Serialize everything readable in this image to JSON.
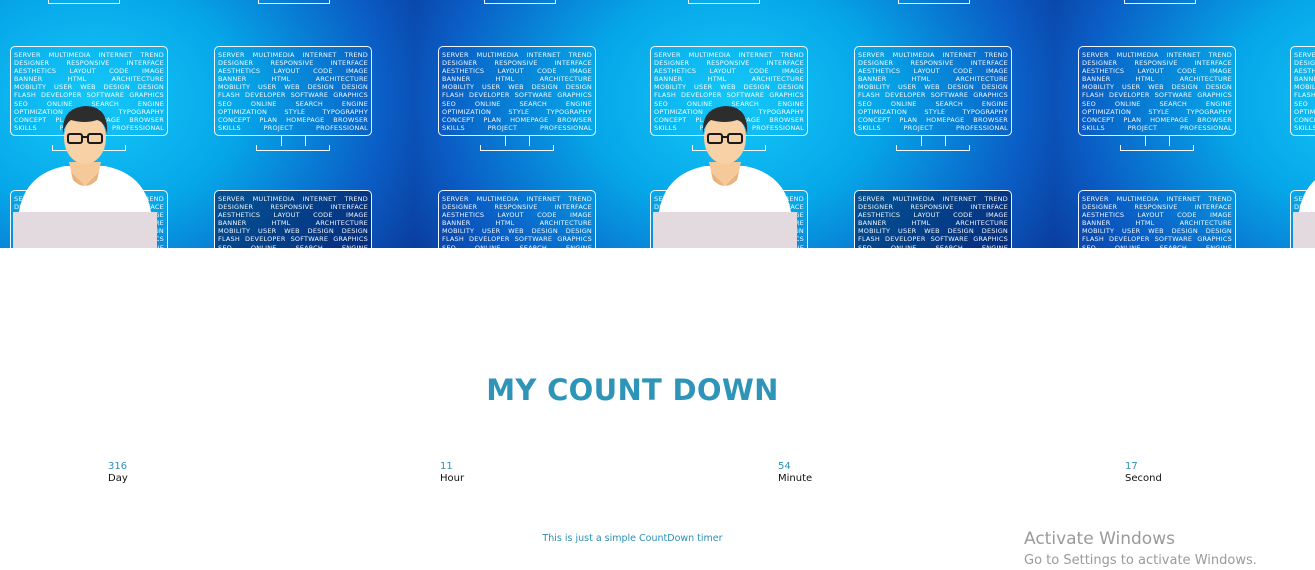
{
  "banner": {
    "alt": "web designer at monitor with keyword word clouds",
    "screen_lines": [
      [
        "SERVER",
        "MULTIMEDIA",
        "INTERNET",
        "TREND"
      ],
      [
        "DESIGNER",
        "RESPONSIVE",
        "INTERFACE"
      ],
      [
        "AESTHETICS",
        "LAYOUT",
        "CODE",
        "IMAGE"
      ],
      [
        "BANNER",
        "HTML",
        "ARCHITECTURE"
      ],
      [
        "MOBILITY",
        "USER",
        "WEB",
        "DESIGN",
        "DESIGN"
      ],
      [
        "FLASH",
        "DEVELOPER",
        "SOFTWARE",
        "GRAPHICS"
      ],
      [
        "SEO",
        "ONLINE",
        "SEARCH",
        "ENGINE"
      ],
      [
        "OPTIMIZATION",
        "STYLE",
        "TYPOGRAPHY"
      ],
      [
        "CONCEPT",
        "PLAN",
        "HOMEPAGE",
        "BROWSER"
      ],
      [
        "SKILLS",
        "PROJECT",
        "PROFESSIONAL"
      ]
    ],
    "colors": {
      "bright": "#14c8f8",
      "deep": "#0a2a86"
    }
  },
  "countdown": {
    "title": "MY COUNT DOWN",
    "units": [
      {
        "value": "316",
        "label": "Day"
      },
      {
        "value": "11",
        "label": "Hour"
      },
      {
        "value": "54",
        "label": "Minute"
      },
      {
        "value": "17",
        "label": "Second"
      }
    ],
    "note": "This is just a simple CountDown timer"
  },
  "watermark": {
    "line1": "Activate Windows",
    "line2": "Go to Settings to activate Windows."
  },
  "colors": {
    "accent": "#2e95b8",
    "text": "#111111"
  }
}
